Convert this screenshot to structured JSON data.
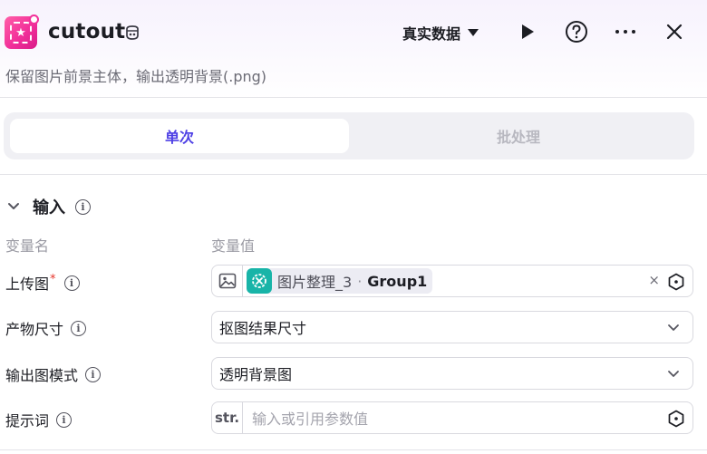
{
  "header": {
    "title": "cutout",
    "subtitle": "保留图片前景主体，输出透明背景(.png)",
    "data_mode": "真实数据"
  },
  "tabs": [
    {
      "label": "单次",
      "active": true
    },
    {
      "label": "批处理",
      "active": false
    }
  ],
  "input_section": {
    "title": "输入",
    "col_name": "变量名",
    "col_value": "变量值",
    "rows": {
      "upload": {
        "label": "上传图",
        "required": "*",
        "chip_name": "图片整理_3",
        "chip_sep": "·",
        "chip_group": "Group1",
        "clear": "×"
      },
      "size": {
        "label": "产物尺寸",
        "value": "抠图结果尺寸"
      },
      "mode": {
        "label": "输出图模式",
        "value": "透明背景图"
      },
      "prompt": {
        "label": "提示词",
        "type_tag": "str.",
        "placeholder": "输入或引用参数值"
      }
    }
  },
  "colors": {
    "accent": "#4e40e5",
    "app_icon": "#f2309a",
    "chip_icon": "#18b4a8",
    "required": "#e5342b"
  },
  "icons": [
    "app-cutout-icon",
    "ai-badge-icon",
    "chevron-down-icon",
    "play-icon",
    "help-icon",
    "more-icon",
    "close-icon",
    "info-icon",
    "image-icon",
    "reference-icon"
  ]
}
